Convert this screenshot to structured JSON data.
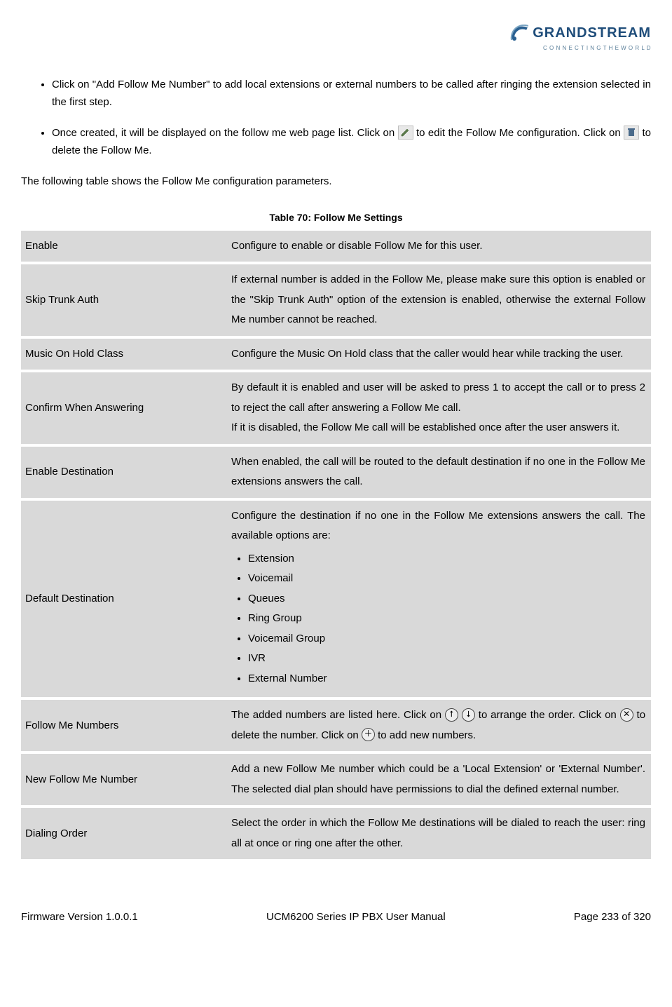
{
  "logo": {
    "name": "GRANDSTREAM",
    "tagline": "C O N N E C T I N G   T H E   W O R L D"
  },
  "bullets": {
    "b1": "Click on \"Add Follow Me Number\" to add local extensions or external numbers to be called after ringing the extension selected in the first step.",
    "b2a": "Once created, it will be displayed on the follow me web page list. Click on ",
    "b2b": " to edit the Follow Me configuration. Click on ",
    "b2c": " to delete the Follow Me."
  },
  "intro": "The following table shows the Follow Me configuration parameters.",
  "table_caption": "Table 70: Follow Me Settings",
  "rows": {
    "enable": {
      "label": "Enable",
      "desc": "Configure to enable or disable Follow Me for this user."
    },
    "skip": {
      "label": "Skip Trunk Auth",
      "desc": "If external number is added in the Follow Me, please make sure this option is enabled or the \"Skip Trunk Auth\" option of the extension is enabled, otherwise the external Follow Me number cannot be reached."
    },
    "moh": {
      "label": "Music On Hold Class",
      "desc": "Configure the Music On Hold class that the caller would hear while tracking the user."
    },
    "confirm": {
      "label": "Confirm When Answering",
      "desc1": "By default it is enabled and user will be asked to press 1 to accept the call or to press 2 to reject the call after answering a Follow Me call.",
      "desc2": "If it is disabled, the Follow Me call will be established once after the user answers it."
    },
    "enabledest": {
      "label": "Enable Destination",
      "desc": "When enabled, the call will be routed to the default destination if no one in the Follow Me extensions answers the call."
    },
    "defaultdest": {
      "label": "Default Destination",
      "intro": "Configure the destination if no one in the Follow Me extensions answers the call. The available options are:",
      "opts": [
        "Extension",
        "Voicemail",
        "Queues",
        "Ring Group",
        "Voicemail Group",
        "IVR",
        "External Number"
      ]
    },
    "fmn": {
      "label": "Follow Me Numbers",
      "p1": "The added numbers are listed here. Click on ",
      "p2": " to arrange the order. Click on ",
      "p3": " to delete the number. Click on ",
      "p4": " to add new numbers."
    },
    "newfm": {
      "label": "New Follow Me Number",
      "desc": "Add a new Follow Me number which could be a 'Local Extension' or 'External Number'. The selected dial plan should have permissions to dial the defined external number."
    },
    "dial": {
      "label": "Dialing Order",
      "desc": "Select the order in which the Follow Me destinations will be dialed to reach the user: ring all at once or ring one after the other."
    }
  },
  "footer": {
    "left": "Firmware Version 1.0.0.1",
    "center": "UCM6200 Series IP PBX User Manual",
    "right": "Page 233 of 320"
  }
}
